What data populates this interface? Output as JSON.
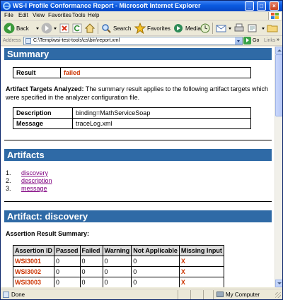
{
  "window": {
    "title": "WS-I Profile Conformance Report - Microsoft Internet Explorer"
  },
  "menu": [
    "File",
    "Edit",
    "View",
    "Favorites",
    "Tools",
    "Help"
  ],
  "toolbar": {
    "back": "Back",
    "search": "Search",
    "favorites": "Favorites",
    "media": "Media"
  },
  "address": {
    "label": "Address",
    "url": "C:\\Temp\\wsi-test-tools\\cs\\bin\\report.xml",
    "go": "Go",
    "links": "Links",
    "links_chevron": "»"
  },
  "summary": {
    "heading": "Summary",
    "result_label": "Result",
    "result_value": "failed",
    "targets_bold": "Artifact Targets Analyzed:",
    "targets_text": " The summary result applies to the following artifact targets which were specified in the analyzer configuration file.",
    "description_label": "Description",
    "description_value": "binding=MathServiceSoap",
    "message_label": "Message",
    "message_value": "traceLog.xml"
  },
  "artifacts": {
    "heading": "Artifacts",
    "items": [
      {
        "num": "1.",
        "label": "discovery"
      },
      {
        "num": "2.",
        "label": "description"
      },
      {
        "num": "3.",
        "label": "message"
      }
    ]
  },
  "discovery": {
    "heading": "Artifact: discovery",
    "summary_title": "Assertion Result Summary:",
    "columns": [
      "Assertion ID",
      "Passed",
      "Failed",
      "Warning",
      "Not Applicable",
      "Missing Input"
    ],
    "rows": [
      [
        "WSI3001",
        "0",
        "0",
        "0",
        "0",
        "X"
      ],
      [
        "WSI3002",
        "0",
        "0",
        "0",
        "0",
        "X"
      ],
      [
        "WSI3003",
        "0",
        "0",
        "0",
        "0",
        "X"
      ]
    ]
  },
  "status": {
    "text": "Done",
    "zone": "My Computer"
  },
  "colors": {
    "section_header": "#2f6aa6",
    "failed": "#cc3300",
    "visited_link": "#800080",
    "titlebar": "#0a5ae0"
  }
}
